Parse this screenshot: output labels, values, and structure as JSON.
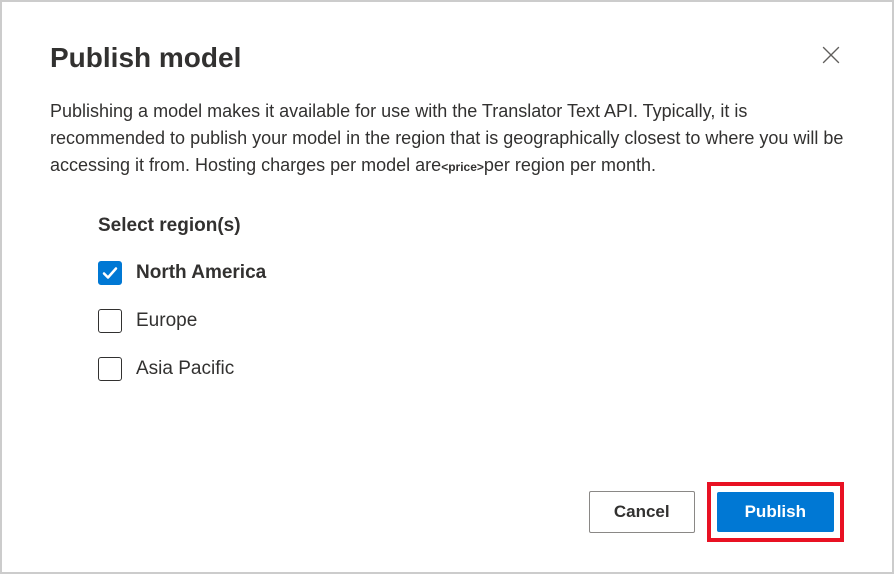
{
  "dialog": {
    "title": "Publish model",
    "description_part1": "Publishing a model makes it available for use with the Translator Text API. Typically, it is recommended to publish your model in the region that is geographically closest to where you will be accessing it from. Hosting charges per model are",
    "price_placeholder": "<price>",
    "description_part2": "per region per month."
  },
  "regions": {
    "label": "Select region(s)",
    "options": [
      {
        "label": "North America",
        "checked": true
      },
      {
        "label": "Europe",
        "checked": false
      },
      {
        "label": "Asia Pacific",
        "checked": false
      }
    ]
  },
  "footer": {
    "cancel": "Cancel",
    "publish": "Publish"
  }
}
